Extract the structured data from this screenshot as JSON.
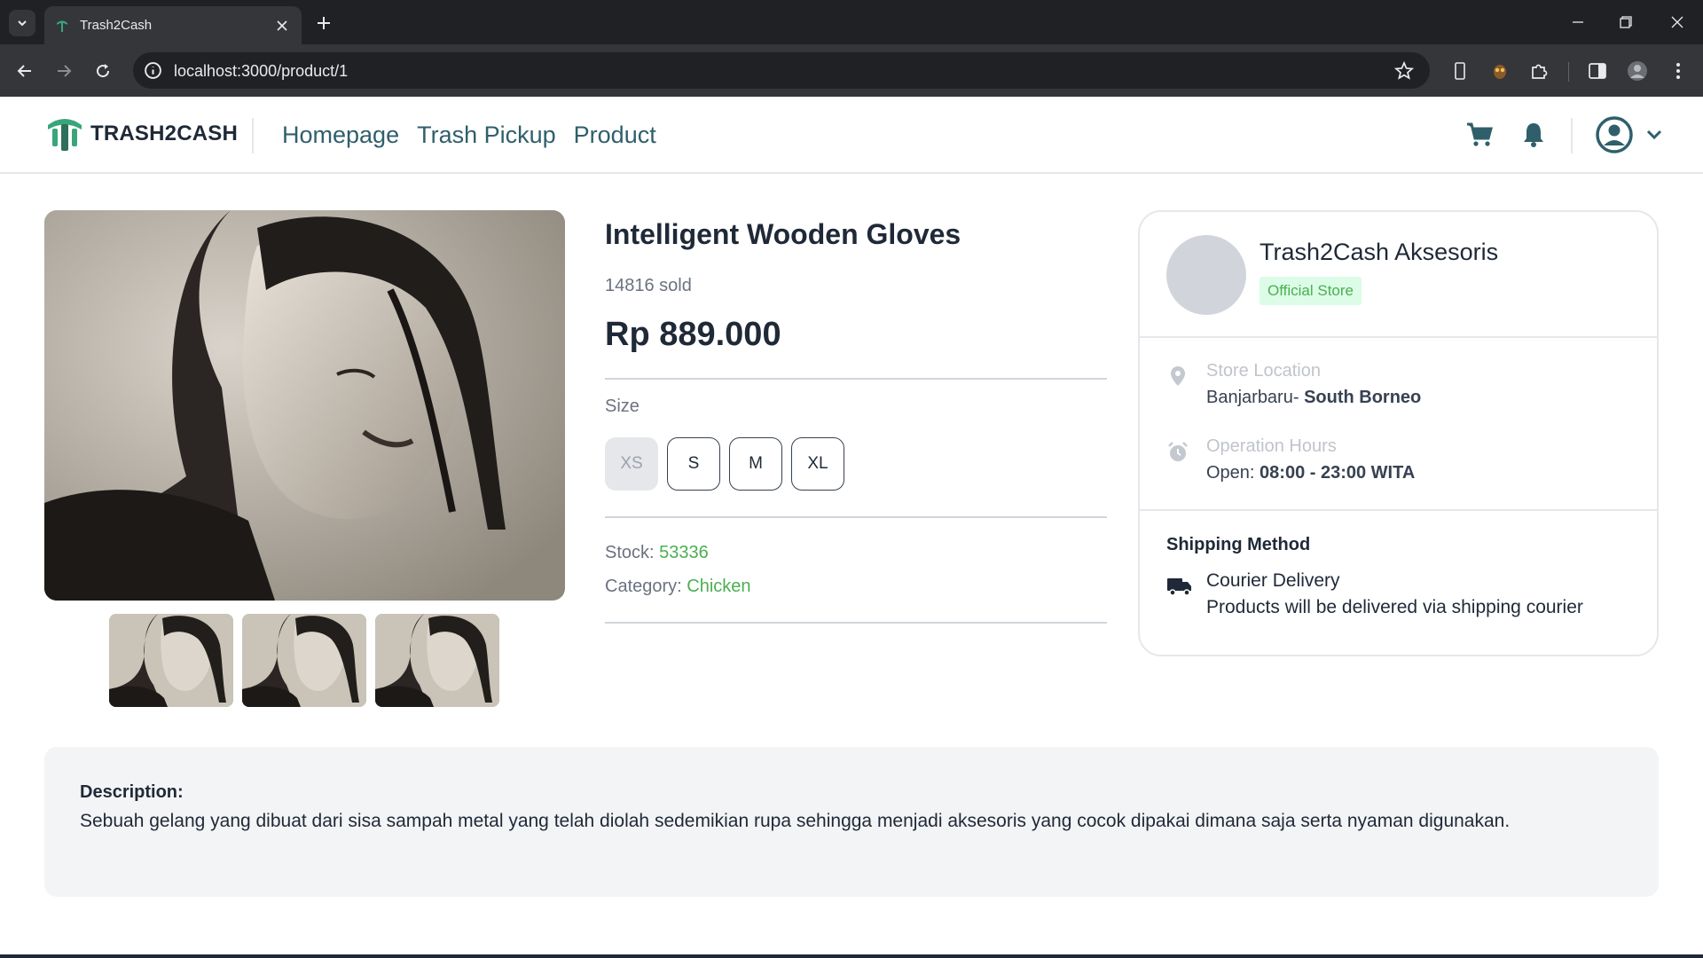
{
  "browser": {
    "tab_title": "Trash2Cash",
    "url": "localhost:3000/product/1"
  },
  "header": {
    "logo_text": "TRASH2CASH",
    "nav": [
      "Homepage",
      "Trash Pickup",
      "Product"
    ],
    "accent_color": "#2f5f6b"
  },
  "product": {
    "name": "Intelligent Wooden Gloves",
    "sold": "14816 sold",
    "price": "Rp 889.000",
    "size_label": "Size",
    "sizes": [
      {
        "label": "XS",
        "available": false
      },
      {
        "label": "S",
        "available": true
      },
      {
        "label": "M",
        "available": true
      },
      {
        "label": "XL",
        "available": true
      }
    ],
    "stock_label": "Stock: ",
    "stock_value": "53336",
    "category_label": "Category: ",
    "category_value": "Chicken",
    "highlight_color": "#4caf50"
  },
  "store": {
    "name": "Trash2Cash Aksesoris",
    "badge": "Official Store",
    "location_label": "Store Location",
    "location_city": "Banjarbaru- ",
    "location_region": "South Borneo",
    "hours_label": "Operation Hours",
    "hours_prefix": "Open: ",
    "hours_value": "08:00 - 23:00 WITA",
    "shipping_title": "Shipping Method",
    "shipping_name": "Courier Delivery",
    "shipping_desc": "Products will be delivered via shipping courier"
  },
  "description": {
    "title": "Description:",
    "text": "Sebuah gelang yang dibuat dari sisa sampah metal yang telah diolah sedemikian rupa sehingga menjadi aksesoris yang cocok dipakai dimana saja serta nyaman digunakan."
  }
}
